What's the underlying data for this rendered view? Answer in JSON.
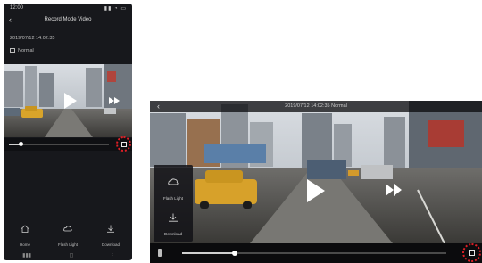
{
  "colors": {
    "background": "#ffffff",
    "app_dark": "#17181c",
    "highlight_ring": "#e01f26",
    "progress_fill": "#d0d0d0"
  },
  "portrait": {
    "status_bar": {
      "time": "12:00",
      "icons": "▮▮ ◔ ▭"
    },
    "header": {
      "back_icon": "chevron-left-icon",
      "title": "Record Mode Video"
    },
    "recording_date": "2019/07/12 14:02:35",
    "mode": {
      "icon": "frame-icon",
      "label": "Normal"
    },
    "player": {
      "play_icon": "play-icon",
      "skip_icon": "fast-forward-icon",
      "progress": 0.12,
      "fullscreen_icon": "fullscreen-icon"
    },
    "bottom_nav": [
      {
        "icon": "home-icon",
        "label": "Home"
      },
      {
        "icon": "cloud-icon",
        "label": "Flash Light"
      },
      {
        "icon": "download-icon",
        "label": "Download"
      }
    ],
    "system_nav": [
      "▮▮▮",
      "◻",
      "‹"
    ]
  },
  "landscape": {
    "header": {
      "back_icon": "chevron-left-icon",
      "title": "2019/07/12 14:02:35 Normal"
    },
    "side_menu": [
      {
        "icon": "cloud-icon",
        "label": "Flash Light"
      },
      {
        "icon": "download-icon",
        "label": "Download"
      }
    ],
    "player": {
      "play_icon": "play-icon",
      "skip_icon": "fast-forward-icon",
      "lock_icon": "lock-icon",
      "progress": 0.2,
      "fullscreen_icon": "fullscreen-icon"
    }
  }
}
